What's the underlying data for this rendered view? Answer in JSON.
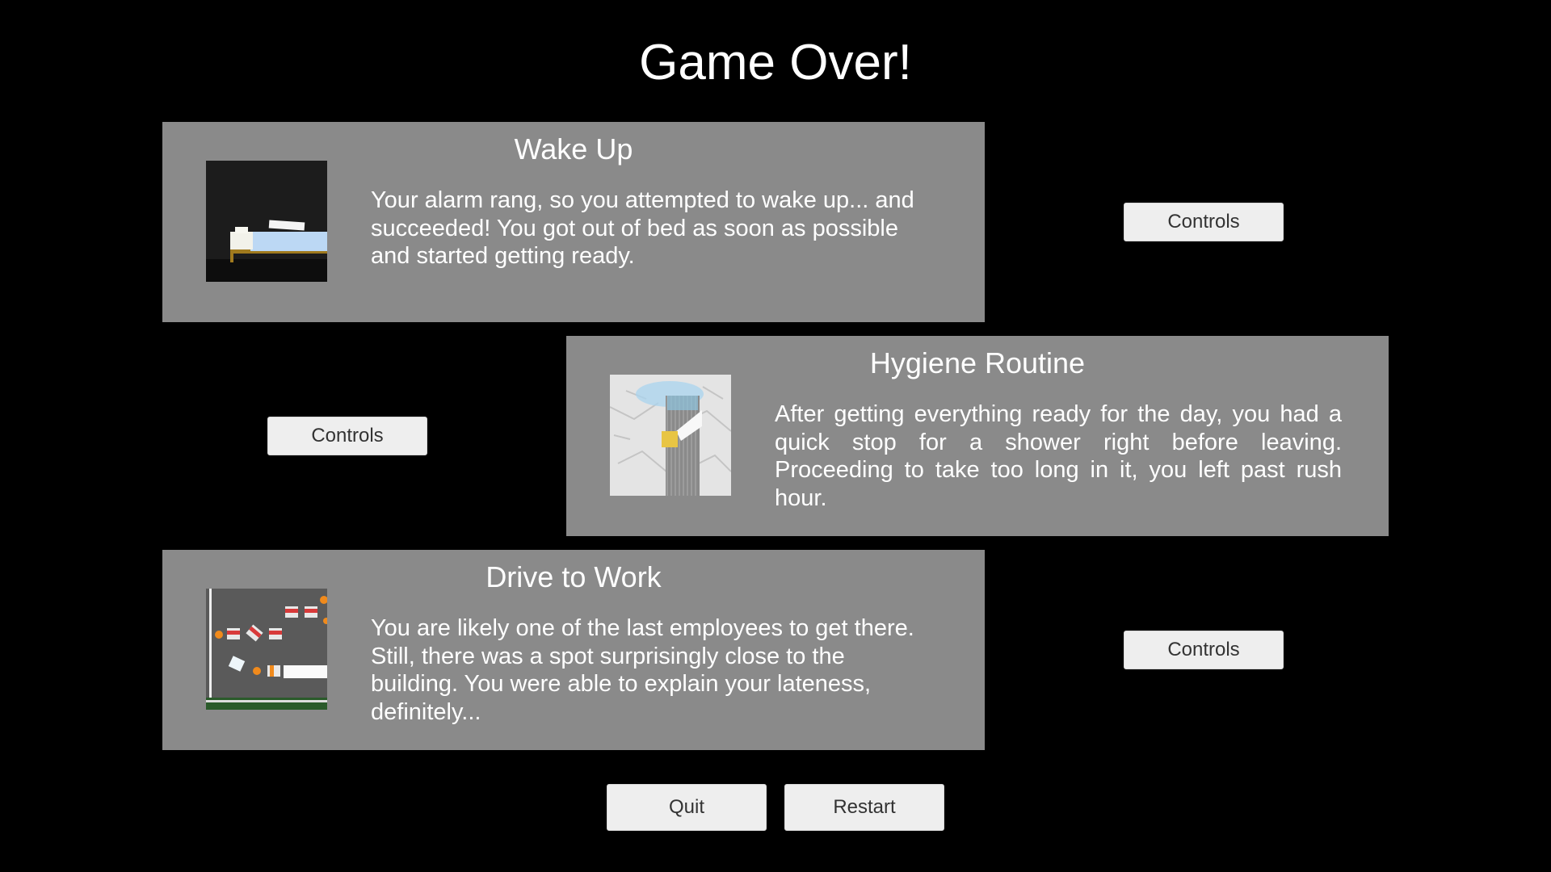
{
  "title": "Game Over!",
  "panels": [
    {
      "title": "Wake Up",
      "text": "Your alarm rang, so you attempted to wake up... and succeeded! You got out of bed as soon as possible and started getting ready.",
      "thumbnail": "bed-scene",
      "button": "Controls"
    },
    {
      "title": "Hygiene Routine",
      "text": "After getting everything ready for the day, you had a quick stop for a shower right before leaving. Proceeding to take too long in it, you left past rush hour.",
      "thumbnail": "shower-scene",
      "button": "Controls"
    },
    {
      "title": "Drive to Work",
      "text": "You are likely one of the last employees to get there. Still, there was a spot surprisingly close to the building. You were able to explain your lateness, definitely...",
      "thumbnail": "parking-lot-scene",
      "button": "Controls"
    }
  ],
  "buttons": {
    "quit": "Quit",
    "restart": "Restart"
  },
  "colors": {
    "background": "#000000",
    "panel": "#8a8a8a",
    "button": "#eeeeee",
    "text": "#ffffff"
  }
}
